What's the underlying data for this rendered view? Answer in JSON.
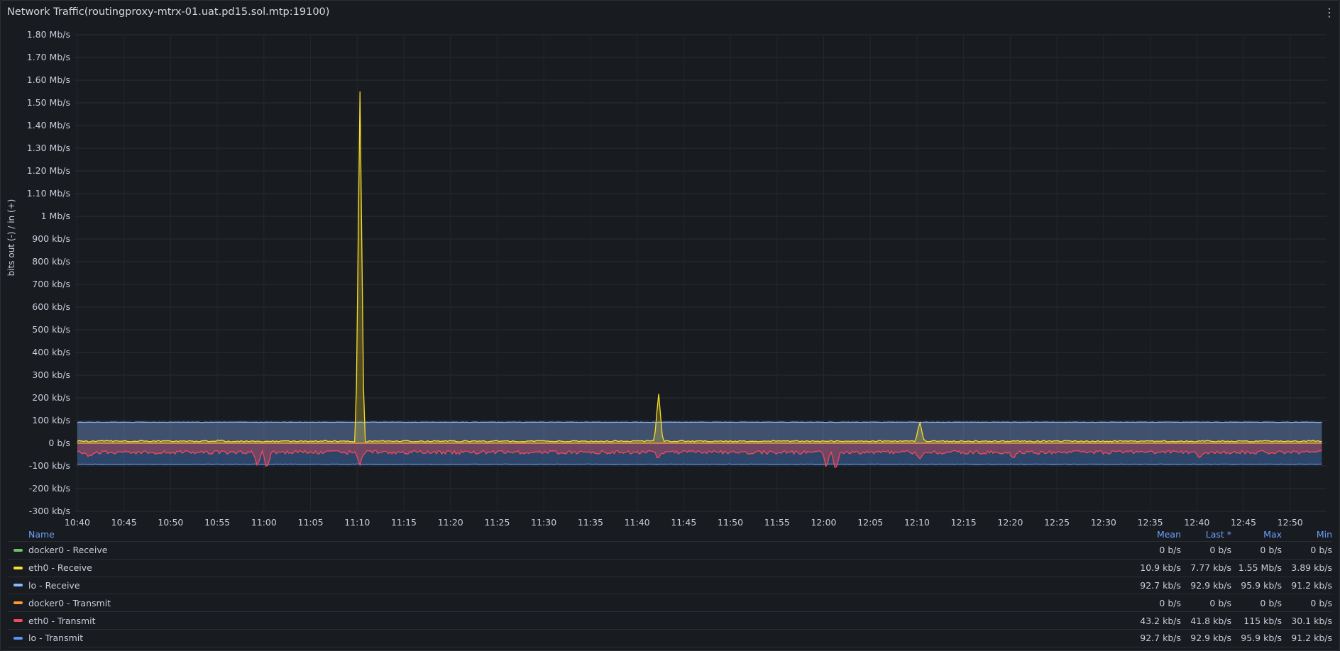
{
  "panel": {
    "title": "Network Traffic(routingproxy-mtrx-01.uat.pd15.sol.mtp:19100)",
    "menu_icon": "vertical-ellipsis-icon"
  },
  "chart_data": {
    "type": "area",
    "ylabel": "bits out (-) / in (+)",
    "y_unit": "b/s",
    "ylim": [
      -300000,
      1800000
    ],
    "y_ticks": [
      -300000,
      -200000,
      -100000,
      0,
      100000,
      200000,
      300000,
      400000,
      500000,
      600000,
      700000,
      800000,
      900000,
      1000000,
      1100000,
      1200000,
      1300000,
      1400000,
      1500000,
      1600000,
      1700000,
      1800000
    ],
    "y_tick_labels": [
      "-300 kb/s",
      "-200 kb/s",
      "-100 kb/s",
      "0 b/s",
      "100 kb/s",
      "200 kb/s",
      "300 kb/s",
      "400 kb/s",
      "500 kb/s",
      "600 kb/s",
      "700 kb/s",
      "800 kb/s",
      "900 kb/s",
      "1 Mb/s",
      "1.10 Mb/s",
      "1.20 Mb/s",
      "1.30 Mb/s",
      "1.40 Mb/s",
      "1.50 Mb/s",
      "1.60 Mb/s",
      "1.70 Mb/s",
      "1.80 Mb/s"
    ],
    "xlim": [
      "10:40",
      "12:54"
    ],
    "x_ticks": [
      "10:40",
      "10:45",
      "10:50",
      "10:55",
      "11:00",
      "11:05",
      "11:10",
      "11:15",
      "11:20",
      "11:25",
      "11:30",
      "11:35",
      "11:40",
      "11:45",
      "11:50",
      "11:55",
      "12:00",
      "12:05",
      "12:10",
      "12:15",
      "12:20",
      "12:25",
      "12:30",
      "12:35",
      "12:40",
      "12:45",
      "12:50"
    ],
    "grid": true,
    "legend_placement": "bottom",
    "series": [
      {
        "name": "docker0 - Receive",
        "color": "#73bf69",
        "baseline": 0,
        "noise": 0,
        "spikes": []
      },
      {
        "name": "eth0 - Receive",
        "color": "#fade2a",
        "baseline": 9000,
        "noise": 3000,
        "spikes": [
          [
            "11:10",
            1550000
          ],
          [
            "11:42",
            225000
          ],
          [
            "12:10",
            95000
          ],
          [
            "10:40",
            12000
          ],
          [
            "10:55",
            14000
          ],
          [
            "11:15",
            15000
          ],
          [
            "11:40",
            14000
          ],
          [
            "11:55",
            13000
          ],
          [
            "12:40",
            13000
          ],
          [
            "12:52",
            12000
          ]
        ]
      },
      {
        "name": "lo - Receive",
        "color": "#8ab8ff",
        "baseline": 92700,
        "noise": 800,
        "spikes": []
      },
      {
        "name": "docker0 - Transmit",
        "color": "#ff9830",
        "baseline": 0,
        "noise": 0,
        "spikes": []
      },
      {
        "name": "eth0 - Transmit",
        "color": "#f2495c",
        "baseline": -40000,
        "noise": 8000,
        "spikes": [
          [
            "10:41",
            -60000
          ],
          [
            "10:59",
            -110000
          ],
          [
            "11:00",
            -115000
          ],
          [
            "11:10",
            -90000
          ],
          [
            "11:42",
            -70000
          ],
          [
            "12:00",
            -105000
          ],
          [
            "12:01",
            -120000
          ],
          [
            "12:10",
            -75000
          ],
          [
            "12:20",
            -70000
          ],
          [
            "12:40",
            -75000
          ]
        ]
      },
      {
        "name": "lo - Transmit",
        "color": "#5794f2",
        "baseline": -92700,
        "noise": 800,
        "spikes": []
      }
    ]
  },
  "legend": {
    "headers": {
      "name": "Name",
      "mean": "Mean",
      "last": "Last *",
      "max": "Max",
      "min": "Min"
    },
    "rows": [
      {
        "name": "docker0 - Receive",
        "color": "#73bf69",
        "mean": "0 b/s",
        "last": "0 b/s",
        "max": "0 b/s",
        "min": "0 b/s"
      },
      {
        "name": "eth0 - Receive",
        "color": "#fade2a",
        "mean": "10.9 kb/s",
        "last": "7.77 kb/s",
        "max": "1.55 Mb/s",
        "min": "3.89 kb/s"
      },
      {
        "name": "lo - Receive",
        "color": "#8ab8ff",
        "mean": "92.7 kb/s",
        "last": "92.9 kb/s",
        "max": "95.9 kb/s",
        "min": "91.2 kb/s"
      },
      {
        "name": "docker0 - Transmit",
        "color": "#ff9830",
        "mean": "0 b/s",
        "last": "0 b/s",
        "max": "0 b/s",
        "min": "0 b/s"
      },
      {
        "name": "eth0 - Transmit",
        "color": "#f2495c",
        "mean": "43.2 kb/s",
        "last": "41.8 kb/s",
        "max": "115 kb/s",
        "min": "30.1 kb/s"
      },
      {
        "name": "lo - Transmit",
        "color": "#5794f2",
        "mean": "92.7 kb/s",
        "last": "92.9 kb/s",
        "max": "95.9 kb/s",
        "min": "91.2 kb/s"
      }
    ]
  }
}
